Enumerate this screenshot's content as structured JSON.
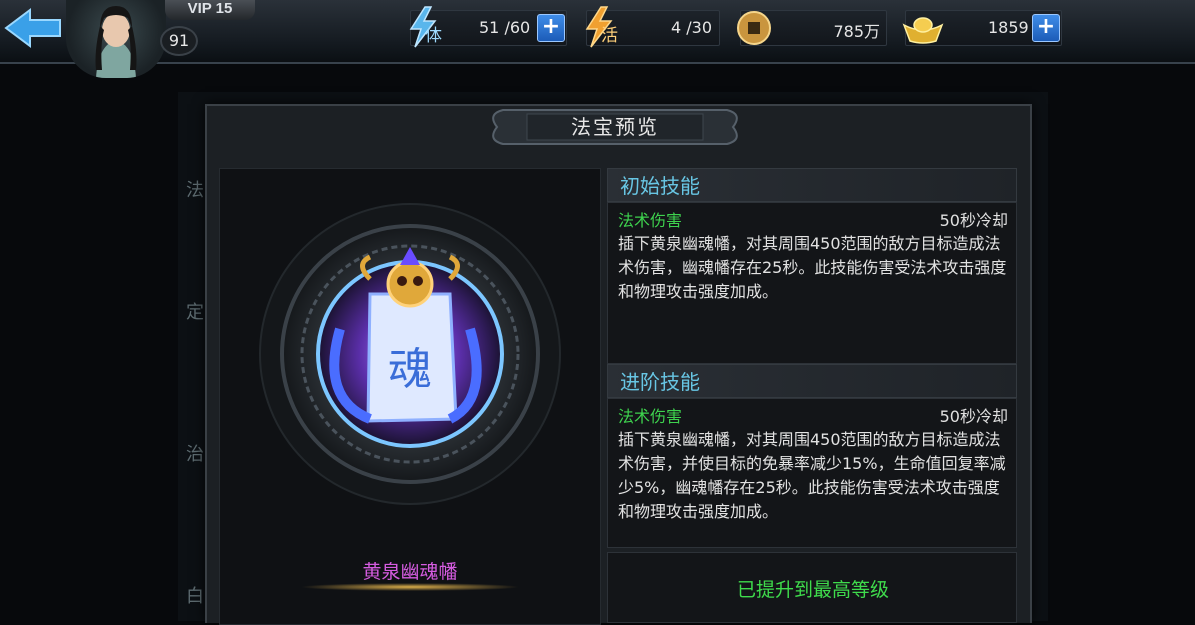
{
  "player": {
    "vip": "VIP 15",
    "level": "91"
  },
  "resources": {
    "stamina": {
      "icon_text": "体",
      "value": "51 /60"
    },
    "activity": {
      "icon_text": "活",
      "value": "4 /30"
    },
    "coins": {
      "value": "785万"
    },
    "gold": {
      "value": "1859"
    }
  },
  "background_labels": [
    "法",
    "定",
    "治",
    "白"
  ],
  "dialog": {
    "title": "法宝预览",
    "item_name": "黄泉幽魂幡",
    "item_glyph": "魂",
    "initial_skill": {
      "header": "初始技能",
      "type": "法术伤害",
      "cooldown": "50秒冷却",
      "description": "插下黄泉幽魂幡，对其周围450范围的敌方目标造成法术伤害，幽魂幡存在25秒。此技能伤害受法术攻击强度和物理攻击强度加成。"
    },
    "advanced_skill": {
      "header": "进阶技能",
      "type": "法术伤害",
      "cooldown": "50秒冷却",
      "description": "插下黄泉幽魂幡，对其周围450范围的敌方目标造成法术伤害，并使目标的免暴率减少15%，生命值回复率减少5%，幽魂幡存在25秒。此技能伤害受法术攻击强度和物理攻击强度加成。"
    },
    "status": "已提升到最高等级"
  },
  "colors": {
    "skill_header": "#68c6e4",
    "skill_type": "#3ed24e",
    "item_name": "#d55ce0",
    "status": "#3fdc4c"
  }
}
